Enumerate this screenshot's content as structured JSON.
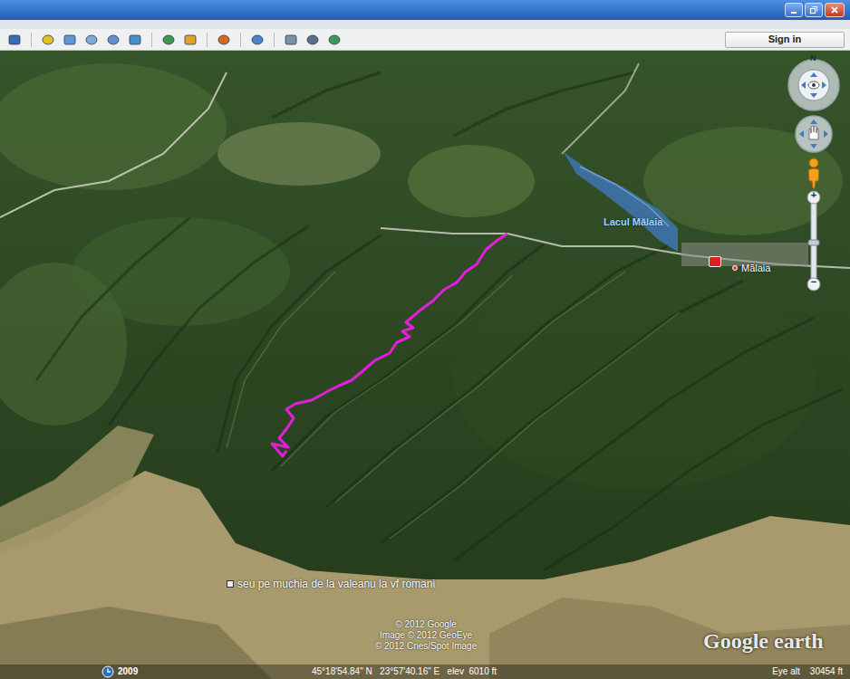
{
  "toolbar": {
    "sign_in": "Sign in"
  },
  "map": {
    "labels": [
      {
        "text": "Lacul Mălaia",
        "kind": "water"
      },
      {
        "text": "Mălaia",
        "kind": "town"
      },
      {
        "text": "seu pe muchia de la valeanu la vf romani",
        "kind": "placemark"
      }
    ],
    "attribution": [
      "© 2012 Google",
      "Image © 2012 GeoEye",
      "© 2012 Cnes/Spot Image"
    ],
    "logo": "Google earth"
  },
  "navigation": {
    "north": "N",
    "zoom_in": "+",
    "zoom_out": "−"
  },
  "status_bar": {
    "year": "2009",
    "position": "45°18'54.84\" N   23°57'40.16\" E   elev  6010 ft",
    "eye_alt": "Eye alt    30454 ft"
  }
}
